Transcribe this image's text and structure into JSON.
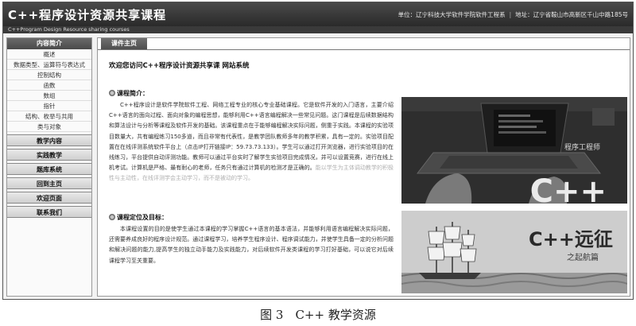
{
  "header": {
    "title": "C++程序设计资源共享课程",
    "subtitle": "C++Program Design Resource sharing courses",
    "unit": "单位：辽宁科技大学软件学院软件工程系",
    "address": "地址：辽宁省鞍山市高新区千山中路185号"
  },
  "sidebar": {
    "heading": "内容简介",
    "sub_items": [
      "概述",
      "数据类型、运算符与表达式",
      "控制结构",
      "函数",
      "数组",
      "指针",
      "结构、枚举与共用",
      "类与对象"
    ],
    "main_items": [
      "教学内容",
      "实践教学",
      "题库系统",
      "回到主页",
      "欢迎页面",
      "联系我们"
    ]
  },
  "main": {
    "tab": "课件主页",
    "welcome": "欢迎您访问C++程序设计资源共享课 网站系统",
    "intro_title": "课程简介：",
    "intro_text": "C++程序设计是软件学院软件工程、网络工程专业的核心专业基础课程。它是软件开发的入门语言，主要介绍C++语言的面向过程、面向对象的编程思想，能够利用C++语言编程解决一些常见问题。这门课程是后续数据结构和算法设计与分析等课程及软件开发的基础。该课程重点在于能够编程解决实际问题，侧重于实践。本课程的实验项目数量大，共有编程练习150多道，而且非常有代表性，是教学团队教师多年的教学积累，具有一定的。实验项目配置在在线评测系统软件平台上（点击IP打开链接IP：59.73.73.133）。学生可以通过打开浏览器，进行实验项目的在线练习，平台提供自动评测功能。教师可以通过平台实时了解学生实验项目完成情况，并可以设置竞赛，进行在线上机考试。计算机是严格、最有耐心的老师，任务只有通过计算机的检测才是正确的。",
    "intro_faded": "能以学生为主体",
    "intro_faded2": "调动教学的积极性与主动性，在线评测学会主动学习，而不是被动的学习。",
    "goal_title": "课程定位及目标：",
    "goal_text": "本课程设置的目的是使学生通过本课程的学习掌握C++语言的基本语法，并能够利用语言编程解决实际问题，还需要养成良好的程序设计规范。通过课程学习，培养学生程序设计、程序调试能力，并使学生具备一定的分析问题和解决问题的能力,提高学生的独立动手能力及实践能力，对后续软件开发类课程的学习打好基础，可以说它对后续课程学习至关重要。",
    "image1_text": "C++",
    "image1_small": "程序工程师",
    "image2_text": "C++远征",
    "image2_small": "之起航篇"
  },
  "caption": "图 3　C++ 教学资源"
}
